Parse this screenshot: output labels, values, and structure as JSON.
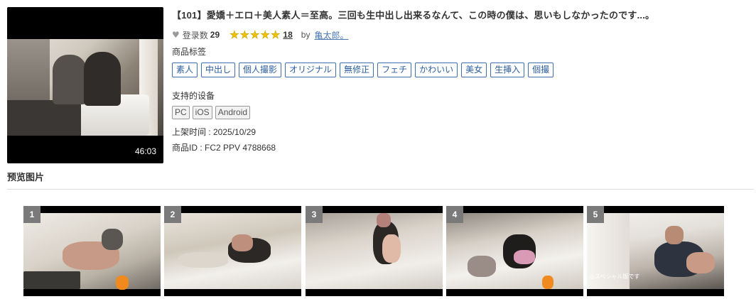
{
  "product": {
    "title": "【101】愛嬌＋エロ＋美人素人＝至高。三回も生中出し出来るなんて、この時の僕は、思いもしなかったのです...。",
    "duration": "46:03",
    "want_label": "登录数",
    "want_count": "29",
    "rating_stars": 5,
    "rating_count": "18",
    "by_label": "by",
    "seller": "亀太郎。",
    "tags_label": "商品标签",
    "tags": [
      "素人",
      "中出し",
      "個人撮影",
      "オリジナル",
      "無修正",
      "フェチ",
      "かわいい",
      "美女",
      "生挿入",
      "個撮"
    ],
    "devices_label": "支持的设备",
    "devices": [
      "PC",
      "iOS",
      "Android"
    ],
    "release": "上架时间 : 2025/10/29",
    "product_id": "商品ID : FC2 PPV 4788668"
  },
  "preview": {
    "title": "预览图片",
    "shots": [
      {
        "num": "1",
        "caption": ""
      },
      {
        "num": "2",
        "caption": ""
      },
      {
        "num": "3",
        "caption": ""
      },
      {
        "num": "4",
        "caption": ""
      },
      {
        "num": "5",
        "caption": "◎スペシャル版です"
      }
    ]
  },
  "colors": {
    "tag_border": "#3d6fb0",
    "star": "#f2c200",
    "seller_link": "#4a76b0"
  }
}
